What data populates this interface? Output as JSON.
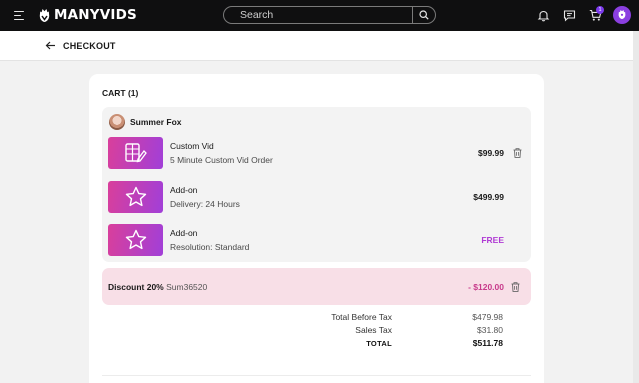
{
  "topbar": {
    "brand": "MANYVIDS",
    "search_placeholder": "Search",
    "cart_count": "1",
    "icons": [
      "menu-icon",
      "search-icon",
      "bell-icon",
      "chat-icon",
      "cart-icon",
      "profile-icon"
    ]
  },
  "subheader": {
    "title": "CHECKOUT"
  },
  "cart": {
    "title": "CART (1)",
    "seller": "Summer Fox",
    "items": [
      {
        "title": "Custom Vid",
        "subtitle": "5 Minute Custom Vid Order",
        "price": "$99.99",
        "icon": "custom-vid-icon",
        "removable": true
      },
      {
        "title": "Add-on",
        "subtitle": "Delivery: 24 Hours",
        "price": "$499.99",
        "icon": "star-icon",
        "removable": false
      },
      {
        "title": "Add-on",
        "subtitle": "Resolution: Standard",
        "price": "FREE",
        "icon": "star-icon",
        "removable": false
      }
    ],
    "discount": {
      "label": "Discount 20%",
      "code": "Sum36520",
      "amount": "- $120.00"
    },
    "totals": {
      "before_tax_label": "Total Before Tax",
      "before_tax_value": "$479.98",
      "tax_label": "Sales Tax",
      "tax_value": "$31.80",
      "total_label": "TOTAL",
      "total_value": "$511.78"
    }
  },
  "colors": {
    "nav_bg": "#0f0f10",
    "accent_purple": "#8b3fe0",
    "thumb_gradient_start": "#d93f9b",
    "thumb_gradient_end": "#a13fd8",
    "discount_bg": "#f8dfe7",
    "discount_text": "#c83a8b",
    "free_text": "#b03bd4"
  }
}
